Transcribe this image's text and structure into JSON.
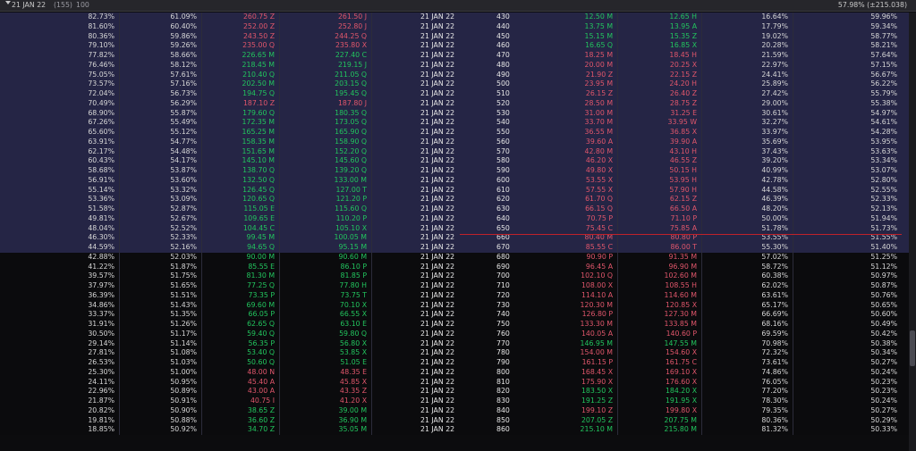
{
  "header": {
    "expiry": "21 JAN 22",
    "count": "(155)",
    "qty": "100",
    "right": "57.98% (±215.038)"
  },
  "rows": [
    {
      "c1": "82.73%",
      "c2": "61.09%",
      "cb": "260.75",
      "cbx": "Z",
      "ca": "261.50",
      "cax": "J",
      "exp": "21 JAN 22",
      "k": "430",
      "pb": "12.50",
      "pbx": "M",
      "pa": "12.65",
      "pax": "H",
      "p1": "16.64%",
      "p2": "59.96%",
      "cs": "r",
      "ps": "g",
      "t": "itm"
    },
    {
      "c1": "81.60%",
      "c2": "60.40%",
      "cb": "252.00",
      "cbx": "Z",
      "ca": "252.80",
      "cax": "J",
      "exp": "21 JAN 22",
      "k": "440",
      "pb": "13.75",
      "pbx": "M",
      "pa": "13.95",
      "pax": "A",
      "p1": "17.79%",
      "p2": "59.34%",
      "cs": "r",
      "ps": "g",
      "t": "itm"
    },
    {
      "c1": "80.36%",
      "c2": "59.86%",
      "cb": "243.50",
      "cbx": "Z",
      "ca": "244.25",
      "cax": "Q",
      "exp": "21 JAN 22",
      "k": "450",
      "pb": "15.15",
      "pbx": "M",
      "pa": "15.35",
      "pax": "Z",
      "p1": "19.02%",
      "p2": "58.77%",
      "cs": "r",
      "ps": "g",
      "t": "itm"
    },
    {
      "c1": "79.10%",
      "c2": "59.26%",
      "cb": "235.00",
      "cbx": "Q",
      "ca": "235.80",
      "cax": "X",
      "exp": "21 JAN 22",
      "k": "460",
      "pb": "16.65",
      "pbx": "Q",
      "pa": "16.85",
      "pax": "X",
      "p1": "20.28%",
      "p2": "58.21%",
      "cs": "r",
      "ps": "g",
      "t": "itm"
    },
    {
      "c1": "77.82%",
      "c2": "58.66%",
      "cb": "226.65",
      "cbx": "M",
      "ca": "227.40",
      "cax": "C",
      "exp": "21 JAN 22",
      "k": "470",
      "pb": "18.25",
      "pbx": "M",
      "pa": "18.45",
      "pax": "H",
      "p1": "21.59%",
      "p2": "57.64%",
      "cs": "g",
      "ps": "r",
      "t": "itm"
    },
    {
      "c1": "76.46%",
      "c2": "58.12%",
      "cb": "218.45",
      "cbx": "M",
      "ca": "219.15",
      "cax": "J",
      "exp": "21 JAN 22",
      "k": "480",
      "pb": "20.00",
      "pbx": "M",
      "pa": "20.25",
      "pax": "X",
      "p1": "22.97%",
      "p2": "57.15%",
      "cs": "g",
      "ps": "r",
      "t": "itm"
    },
    {
      "c1": "75.05%",
      "c2": "57.61%",
      "cb": "210.40",
      "cbx": "Q",
      "ca": "211.05",
      "cax": "Q",
      "exp": "21 JAN 22",
      "k": "490",
      "pb": "21.90",
      "pbx": "Z",
      "pa": "22.15",
      "pax": "Z",
      "p1": "24.41%",
      "p2": "56.67%",
      "cs": "g",
      "ps": "r",
      "t": "itm"
    },
    {
      "c1": "73.57%",
      "c2": "57.16%",
      "cb": "202.50",
      "cbx": "M",
      "ca": "203.15",
      "cax": "Q",
      "exp": "21 JAN 22",
      "k": "500",
      "pb": "23.95",
      "pbx": "M",
      "pa": "24.20",
      "pax": "H",
      "p1": "25.89%",
      "p2": "56.22%",
      "cs": "g",
      "ps": "r",
      "t": "itm"
    },
    {
      "c1": "72.04%",
      "c2": "56.73%",
      "cb": "194.75",
      "cbx": "Q",
      "ca": "195.45",
      "cax": "Q",
      "exp": "21 JAN 22",
      "k": "510",
      "pb": "26.15",
      "pbx": "Z",
      "pa": "26.40",
      "pax": "Z",
      "p1": "27.42%",
      "p2": "55.79%",
      "cs": "g",
      "ps": "r",
      "t": "itm"
    },
    {
      "c1": "70.49%",
      "c2": "56.29%",
      "cb": "187.10",
      "cbx": "Z",
      "ca": "187.80",
      "cax": "J",
      "exp": "21 JAN 22",
      "k": "520",
      "pb": "28.50",
      "pbx": "M",
      "pa": "28.75",
      "pax": "Z",
      "p1": "29.00%",
      "p2": "55.38%",
      "cs": "r",
      "ps": "r",
      "t": "itm"
    },
    {
      "c1": "68.90%",
      "c2": "55.87%",
      "cb": "179.60",
      "cbx": "Q",
      "ca": "180.35",
      "cax": "Q",
      "exp": "21 JAN 22",
      "k": "530",
      "pb": "31.00",
      "pbx": "M",
      "pa": "31.25",
      "pax": "E",
      "p1": "30.61%",
      "p2": "54.97%",
      "cs": "g",
      "ps": "r",
      "t": "itm"
    },
    {
      "c1": "67.26%",
      "c2": "55.49%",
      "cb": "172.35",
      "cbx": "M",
      "ca": "173.05",
      "cax": "Q",
      "exp": "21 JAN 22",
      "k": "540",
      "pb": "33.70",
      "pbx": "M",
      "pa": "33.95",
      "pax": "W",
      "p1": "32.27%",
      "p2": "54.61%",
      "cs": "g",
      "ps": "r",
      "t": "itm"
    },
    {
      "c1": "65.60%",
      "c2": "55.12%",
      "cb": "165.25",
      "cbx": "M",
      "ca": "165.90",
      "cax": "Q",
      "exp": "21 JAN 22",
      "k": "550",
      "pb": "36.55",
      "pbx": "M",
      "pa": "36.85",
      "pax": "X",
      "p1": "33.97%",
      "p2": "54.28%",
      "cs": "g",
      "ps": "r",
      "t": "itm"
    },
    {
      "c1": "63.91%",
      "c2": "54.77%",
      "cb": "158.35",
      "cbx": "M",
      "ca": "158.90",
      "cax": "Q",
      "exp": "21 JAN 22",
      "k": "560",
      "pb": "39.60",
      "pbx": "A",
      "pa": "39.90",
      "pax": "A",
      "p1": "35.69%",
      "p2": "53.95%",
      "cs": "g",
      "ps": "r",
      "t": "itm"
    },
    {
      "c1": "62.17%",
      "c2": "54.48%",
      "cb": "151.65",
      "cbx": "M",
      "ca": "152.20",
      "cax": "Q",
      "exp": "21 JAN 22",
      "k": "570",
      "pb": "42.80",
      "pbx": "M",
      "pa": "43.10",
      "pax": "H",
      "p1": "37.43%",
      "p2": "53.63%",
      "cs": "g",
      "ps": "r",
      "t": "itm"
    },
    {
      "c1": "60.43%",
      "c2": "54.17%",
      "cb": "145.10",
      "cbx": "M",
      "ca": "145.60",
      "cax": "Q",
      "exp": "21 JAN 22",
      "k": "580",
      "pb": "46.20",
      "pbx": "X",
      "pa": "46.55",
      "pax": "Z",
      "p1": "39.20%",
      "p2": "53.34%",
      "cs": "g",
      "ps": "r",
      "t": "itm"
    },
    {
      "c1": "58.68%",
      "c2": "53.87%",
      "cb": "138.70",
      "cbx": "Q",
      "ca": "139.20",
      "cax": "Q",
      "exp": "21 JAN 22",
      "k": "590",
      "pb": "49.80",
      "pbx": "X",
      "pa": "50.15",
      "pax": "H",
      "p1": "40.99%",
      "p2": "53.07%",
      "cs": "g",
      "ps": "r",
      "t": "itm"
    },
    {
      "c1": "56.91%",
      "c2": "53.60%",
      "cb": "132.50",
      "cbx": "Q",
      "ca": "133.00",
      "cax": "M",
      "exp": "21 JAN 22",
      "k": "600",
      "pb": "53.55",
      "pbx": "X",
      "pa": "53.95",
      "pax": "H",
      "p1": "42.78%",
      "p2": "52.80%",
      "cs": "g",
      "ps": "r",
      "t": "itm"
    },
    {
      "c1": "55.14%",
      "c2": "53.32%",
      "cb": "126.45",
      "cbx": "Q",
      "ca": "127.00",
      "cax": "T",
      "exp": "21 JAN 22",
      "k": "610",
      "pb": "57.55",
      "pbx": "X",
      "pa": "57.90",
      "pax": "H",
      "p1": "44.58%",
      "p2": "52.55%",
      "cs": "g",
      "ps": "r",
      "t": "itm"
    },
    {
      "c1": "53.36%",
      "c2": "53.09%",
      "cb": "120.65",
      "cbx": "Q",
      "ca": "121.20",
      "cax": "P",
      "exp": "21 JAN 22",
      "k": "620",
      "pb": "61.70",
      "pbx": "Q",
      "pa": "62.15",
      "pax": "Z",
      "p1": "46.39%",
      "p2": "52.33%",
      "cs": "g",
      "ps": "r",
      "t": "itm"
    },
    {
      "c1": "51.58%",
      "c2": "52.87%",
      "cb": "115.05",
      "cbx": "E",
      "ca": "115.60",
      "cax": "Q",
      "exp": "21 JAN 22",
      "k": "630",
      "pb": "66.15",
      "pbx": "Q",
      "pa": "66.50",
      "pax": "A",
      "p1": "48.20%",
      "p2": "52.13%",
      "cs": "g",
      "ps": "r",
      "t": "itm"
    },
    {
      "c1": "49.81%",
      "c2": "52.67%",
      "cb": "109.65",
      "cbx": "E",
      "ca": "110.20",
      "cax": "P",
      "exp": "21 JAN 22",
      "k": "640",
      "pb": "70.75",
      "pbx": "P",
      "pa": "71.10",
      "pax": "P",
      "p1": "50.00%",
      "p2": "51.94%",
      "cs": "g",
      "ps": "r",
      "t": "itm"
    },
    {
      "c1": "48.04%",
      "c2": "52.52%",
      "cb": "104.45",
      "cbx": "C",
      "ca": "105.10",
      "cax": "X",
      "exp": "21 JAN 22",
      "k": "650",
      "pb": "75.45",
      "pbx": "C",
      "pa": "75.85",
      "pax": "A",
      "p1": "51.78%",
      "p2": "51.73%",
      "cs": "g",
      "ps": "r",
      "t": "itm"
    },
    {
      "c1": "46.30%",
      "c2": "52.33%",
      "cb": "99.45",
      "cbx": "M",
      "ca": "100.05",
      "cax": "M",
      "exp": "21 JAN 22",
      "k": "660",
      "pb": "80.40",
      "pbx": "M",
      "pa": "80.80",
      "pax": "P",
      "p1": "53.55%",
      "p2": "51.55%",
      "cs": "g",
      "ps": "r",
      "t": "itm"
    },
    {
      "c1": "44.59%",
      "c2": "52.16%",
      "cb": "94.65",
      "cbx": "Q",
      "ca": "95.15",
      "cax": "M",
      "exp": "21 JAN 22",
      "k": "670",
      "pb": "85.55",
      "pbx": "C",
      "pa": "86.00",
      "pax": "T",
      "p1": "55.30%",
      "p2": "51.40%",
      "cs": "g",
      "ps": "r",
      "t": "itm"
    },
    {
      "c1": "42.88%",
      "c2": "52.03%",
      "cb": "90.00",
      "cbx": "M",
      "ca": "90.60",
      "cax": "M",
      "exp": "21 JAN 22",
      "k": "680",
      "pb": "90.90",
      "pbx": "P",
      "pa": "91.35",
      "pax": "M",
      "p1": "57.02%",
      "p2": "51.25%",
      "cs": "g",
      "ps": "r",
      "t": "otm"
    },
    {
      "c1": "41.22%",
      "c2": "51.87%",
      "cb": "85.55",
      "cbx": "E",
      "ca": "86.10",
      "cax": "P",
      "exp": "21 JAN 22",
      "k": "690",
      "pb": "96.45",
      "pbx": "A",
      "pa": "96.90",
      "pax": "M",
      "p1": "58.72%",
      "p2": "51.12%",
      "cs": "g",
      "ps": "r",
      "t": "otm"
    },
    {
      "c1": "39.57%",
      "c2": "51.75%",
      "cb": "81.30",
      "cbx": "M",
      "ca": "81.85",
      "cax": "P",
      "exp": "21 JAN 22",
      "k": "700",
      "pb": "102.10",
      "pbx": "Q",
      "pa": "102.60",
      "pax": "M",
      "p1": "60.38%",
      "p2": "50.97%",
      "cs": "g",
      "ps": "r",
      "t": "otm"
    },
    {
      "c1": "37.97%",
      "c2": "51.65%",
      "cb": "77.25",
      "cbx": "Q",
      "ca": "77.80",
      "cax": "H",
      "exp": "21 JAN 22",
      "k": "710",
      "pb": "108.00",
      "pbx": "X",
      "pa": "108.55",
      "pax": "H",
      "p1": "62.02%",
      "p2": "50.87%",
      "cs": "g",
      "ps": "r",
      "t": "otm"
    },
    {
      "c1": "36.39%",
      "c2": "51.51%",
      "cb": "73.35",
      "cbx": "P",
      "ca": "73.75",
      "cax": "T",
      "exp": "21 JAN 22",
      "k": "720",
      "pb": "114.10",
      "pbx": "A",
      "pa": "114.60",
      "pax": "M",
      "p1": "63.61%",
      "p2": "50.76%",
      "cs": "g",
      "ps": "r",
      "t": "otm"
    },
    {
      "c1": "34.86%",
      "c2": "51.43%",
      "cb": "69.60",
      "cbx": "M",
      "ca": "70.10",
      "cax": "X",
      "exp": "21 JAN 22",
      "k": "730",
      "pb": "120.30",
      "pbx": "M",
      "pa": "120.85",
      "pax": "X",
      "p1": "65.17%",
      "p2": "50.65%",
      "cs": "g",
      "ps": "r",
      "t": "otm"
    },
    {
      "c1": "33.37%",
      "c2": "51.35%",
      "cb": "66.05",
      "cbx": "P",
      "ca": "66.55",
      "cax": "X",
      "exp": "21 JAN 22",
      "k": "740",
      "pb": "126.80",
      "pbx": "P",
      "pa": "127.30",
      "pax": "M",
      "p1": "66.69%",
      "p2": "50.60%",
      "cs": "g",
      "ps": "r",
      "t": "otm"
    },
    {
      "c1": "31.91%",
      "c2": "51.26%",
      "cb": "62.65",
      "cbx": "Q",
      "ca": "63.10",
      "cax": "E",
      "exp": "21 JAN 22",
      "k": "750",
      "pb": "133.30",
      "pbx": "M",
      "pa": "133.85",
      "pax": "M",
      "p1": "68.16%",
      "p2": "50.49%",
      "cs": "g",
      "ps": "r",
      "t": "otm"
    },
    {
      "c1": "30.50%",
      "c2": "51.17%",
      "cb": "59.40",
      "cbx": "Q",
      "ca": "59.80",
      "cax": "Q",
      "exp": "21 JAN 22",
      "k": "760",
      "pb": "140.05",
      "pbx": "A",
      "pa": "140.60",
      "pax": "P",
      "p1": "69.59%",
      "p2": "50.42%",
      "cs": "g",
      "ps": "r",
      "t": "otm"
    },
    {
      "c1": "29.14%",
      "c2": "51.14%",
      "cb": "56.35",
      "cbx": "P",
      "ca": "56.80",
      "cax": "X",
      "exp": "21 JAN 22",
      "k": "770",
      "pb": "146.95",
      "pbx": "M",
      "pa": "147.55",
      "pax": "M",
      "p1": "70.98%",
      "p2": "50.38%",
      "cs": "g",
      "ps": "g",
      "t": "otm"
    },
    {
      "c1": "27.81%",
      "c2": "51.08%",
      "cb": "53.40",
      "cbx": "Q",
      "ca": "53.85",
      "cax": "X",
      "exp": "21 JAN 22",
      "k": "780",
      "pb": "154.00",
      "pbx": "M",
      "pa": "154.60",
      "pax": "X",
      "p1": "72.32%",
      "p2": "50.34%",
      "cs": "g",
      "ps": "r",
      "t": "otm"
    },
    {
      "c1": "26.53%",
      "c2": "51.03%",
      "cb": "50.60",
      "cbx": "Q",
      "ca": "51.05",
      "cax": "E",
      "exp": "21 JAN 22",
      "k": "790",
      "pb": "161.15",
      "pbx": "P",
      "pa": "161.75",
      "pax": "C",
      "p1": "73.61%",
      "p2": "50.27%",
      "cs": "g",
      "ps": "r",
      "t": "otm"
    },
    {
      "c1": "25.30%",
      "c2": "51.00%",
      "cb": "48.00",
      "cbx": "N",
      "ca": "48.35",
      "cax": "E",
      "exp": "21 JAN 22",
      "k": "800",
      "pb": "168.45",
      "pbx": "X",
      "pa": "169.10",
      "pax": "X",
      "p1": "74.86%",
      "p2": "50.24%",
      "cs": "r",
      "ps": "r",
      "t": "otm"
    },
    {
      "c1": "24.11%",
      "c2": "50.95%",
      "cb": "45.40",
      "cbx": "A",
      "ca": "45.85",
      "cax": "X",
      "exp": "21 JAN 22",
      "k": "810",
      "pb": "175.90",
      "pbx": "X",
      "pa": "176.60",
      "pax": "X",
      "p1": "76.05%",
      "p2": "50.23%",
      "cs": "r",
      "ps": "r",
      "t": "otm"
    },
    {
      "c1": "22.96%",
      "c2": "50.89%",
      "cb": "43.00",
      "cbx": "A",
      "ca": "43.35",
      "cax": "Z",
      "exp": "21 JAN 22",
      "k": "820",
      "pb": "183.50",
      "pbx": "X",
      "pa": "184.20",
      "pax": "X",
      "p1": "77.20%",
      "p2": "50.23%",
      "cs": "r",
      "ps": "g",
      "t": "otm"
    },
    {
      "c1": "21.87%",
      "c2": "50.91%",
      "cb": "40.75",
      "cbx": "I",
      "ca": "41.20",
      "cax": "X",
      "exp": "21 JAN 22",
      "k": "830",
      "pb": "191.25",
      "pbx": "Z",
      "pa": "191.95",
      "pax": "X",
      "p1": "78.30%",
      "p2": "50.24%",
      "cs": "r",
      "ps": "g",
      "t": "otm"
    },
    {
      "c1": "20.82%",
      "c2": "50.90%",
      "cb": "38.65",
      "cbx": "Z",
      "ca": "39.00",
      "cax": "M",
      "exp": "21 JAN 22",
      "k": "840",
      "pb": "199.10",
      "pbx": "Z",
      "pa": "199.80",
      "pax": "X",
      "p1": "79.35%",
      "p2": "50.27%",
      "cs": "g",
      "ps": "r",
      "t": "otm"
    },
    {
      "c1": "19.81%",
      "c2": "50.88%",
      "cb": "36.60",
      "cbx": "Z",
      "ca": "36.90",
      "cax": "M",
      "exp": "21 JAN 22",
      "k": "850",
      "pb": "207.05",
      "pbx": "Z",
      "pa": "207.75",
      "pax": "M",
      "p1": "80.36%",
      "p2": "50.29%",
      "cs": "g",
      "ps": "g",
      "t": "otm"
    },
    {
      "c1": "18.85%",
      "c2": "50.92%",
      "cb": "34.70",
      "cbx": "Z",
      "ca": "35.05",
      "cax": "M",
      "exp": "21 JAN 22",
      "k": "860",
      "pb": "215.10",
      "pbx": "M",
      "pa": "215.80",
      "pax": "M",
      "p1": "81.32%",
      "p2": "50.33%",
      "cs": "g",
      "ps": "g",
      "t": "otm"
    }
  ],
  "colors": {
    "itm_bg": "#252545",
    "otm_bg": "#0b0b0d",
    "up": "#22c55e",
    "down": "#e0566b",
    "atm_line": "#c0222a"
  }
}
